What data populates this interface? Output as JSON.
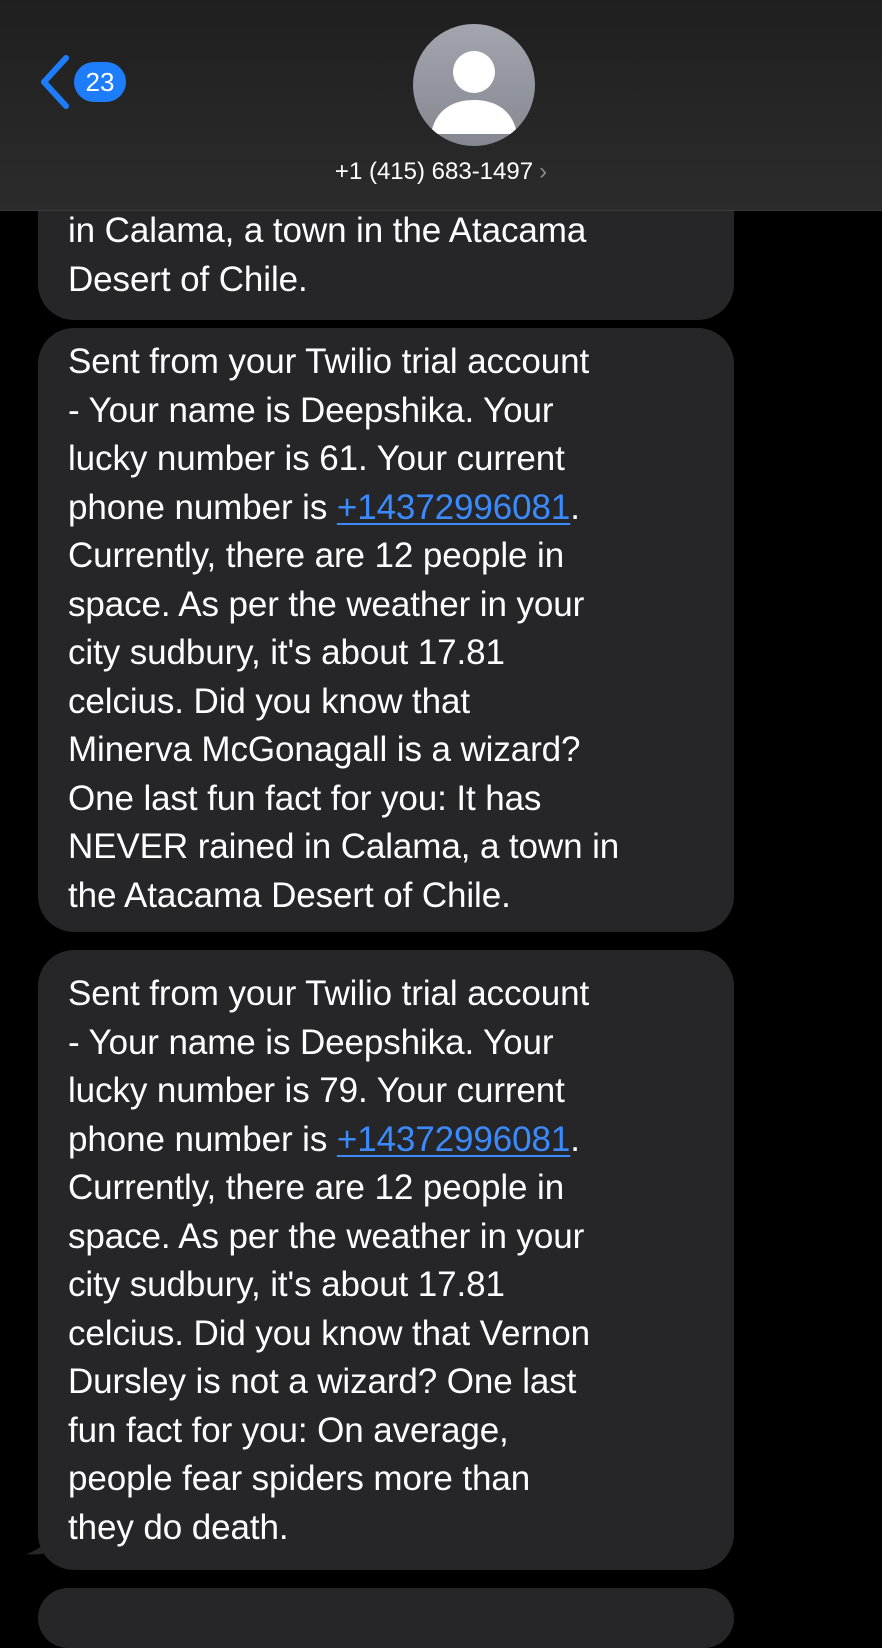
{
  "header": {
    "back_badge": "23",
    "contact_number": "+1 (415) 683-1497",
    "contact_chevron": "›"
  },
  "messages": [
    {
      "lines": [
        "in Calama, a town in the Atacama",
        "Desert of Chile."
      ]
    },
    {
      "lines_before_link": [
        "Sent from your Twilio trial account",
        "- Your name is Deepshika. Your",
        "lucky number is 61. Your current"
      ],
      "link_prefix": "phone number is ",
      "link": "+14372996081",
      "link_suffix": ".",
      "lines_after_link": [
        "Currently, there are 12 people in",
        "space. As per the weather in your",
        "city sudbury, it's about 17.81",
        "celcius. Did you know that",
        "Minerva McGonagall is a wizard?",
        "One last fun fact for you: It has",
        "NEVER rained in Calama, a town in",
        "the Atacama Desert of Chile."
      ]
    },
    {
      "lines_before_link": [
        "Sent from your Twilio trial account",
        "- Your name is Deepshika. Your",
        "lucky number is 79. Your current"
      ],
      "link_prefix": "phone number is ",
      "link": "+14372996081",
      "link_suffix": ".",
      "lines_after_link": [
        "Currently, there are 12 people in",
        "space. As per the weather in your",
        "city sudbury, it's about 17.81",
        "celcius. Did you know that Vernon",
        "Dursley is not a wizard? One last",
        "fun fact for you: On average,",
        "people fear spiders more than",
        "they do death."
      ]
    }
  ],
  "colors": {
    "background": "#000000",
    "bubble": "#262628",
    "accent": "#1e7dfa",
    "link": "#3b8bff"
  },
  "icons": {
    "back": "chevron-left-icon",
    "avatar": "person-silhouette-icon",
    "contact_details": "chevron-right-icon"
  }
}
